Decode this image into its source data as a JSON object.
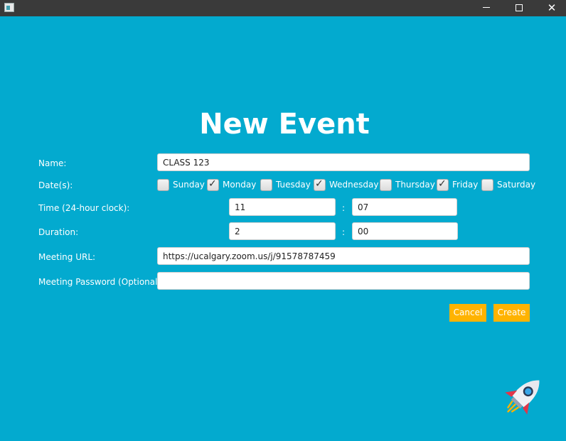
{
  "window": {
    "minimize_icon": "minimize-icon",
    "maximize_icon": "maximize-icon",
    "close_glyph": "✕"
  },
  "heading": "New Event",
  "form": {
    "name_label": "Name:",
    "name_value": "CLASS 123",
    "dates_label": "Date(s):",
    "days": [
      {
        "label": "Sunday",
        "checked": false
      },
      {
        "label": "Monday",
        "checked": true
      },
      {
        "label": "Tuesday",
        "checked": false
      },
      {
        "label": "Wednesday",
        "checked": true
      },
      {
        "label": "Thursday",
        "checked": false
      },
      {
        "label": "Friday",
        "checked": true
      },
      {
        "label": "Saturday",
        "checked": false
      }
    ],
    "time_label": "Time (24-hour clock):",
    "time_hour": "11",
    "time_minute": "07",
    "time_sep": ":",
    "duration_label": "Duration:",
    "duration_hours": "2",
    "duration_minutes": "00",
    "duration_sep": ":",
    "url_label": "Meeting URL:",
    "url_value": "https://ucalgary.zoom.us/j/91578787459",
    "password_label": "Meeting Password (Optional):",
    "password_value": ""
  },
  "buttons": {
    "cancel": "Cancel",
    "create": "Create"
  },
  "colors": {
    "background": "#03aacf",
    "button": "#ffb300",
    "titlebar": "#3a3a3a"
  },
  "decoration": {
    "icon": "rocket-icon"
  }
}
